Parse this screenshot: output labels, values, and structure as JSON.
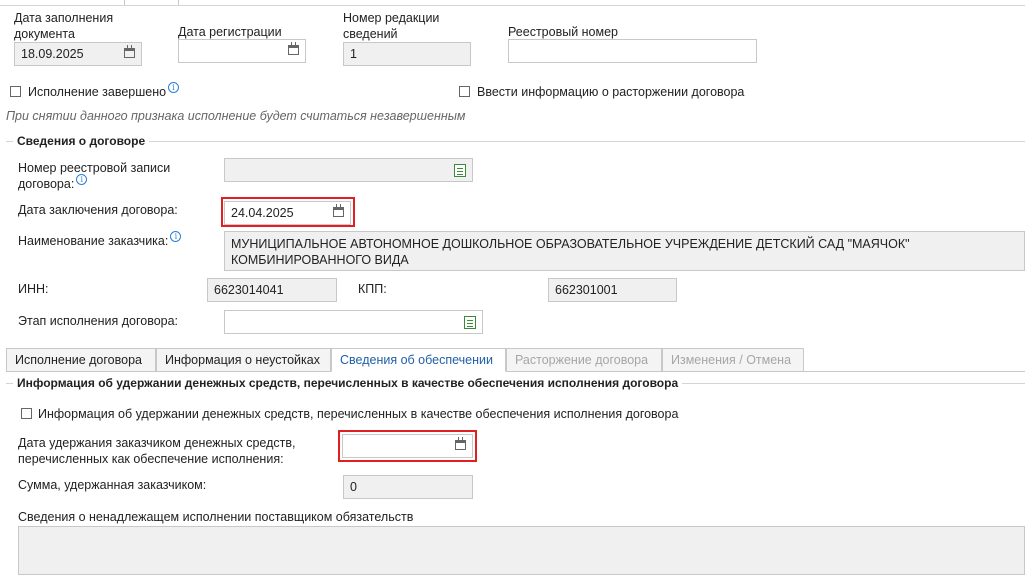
{
  "header": {
    "fill_date": {
      "label": "Дата заполнения документа",
      "value": "18.09.2025"
    },
    "reg_date": {
      "label": "Дата регистрации",
      "value": ""
    },
    "revision": {
      "label": "Номер редакции сведений",
      "value": "1"
    },
    "registry": {
      "label": "Реестровый номер",
      "value": ""
    },
    "completed_label": "Исполнение завершено",
    "termination_label": "Ввести информацию о расторжении договора",
    "hint": "При снятии данного признака исполнение будет считаться незавершенным"
  },
  "contract": {
    "section_title": "Сведения о договоре",
    "record_number": {
      "label": "Номер реестровой записи договора:",
      "value": ""
    },
    "conclusion_date": {
      "label": "Дата заключения договора:",
      "value": "24.04.2025"
    },
    "customer": {
      "label": "Наименование заказчика:",
      "value": "МУНИЦИПАЛЬНОЕ АВТОНОМНОЕ ДОШКОЛЬНОЕ ОБРАЗОВАТЕЛЬНОЕ УЧРЕЖДЕНИЕ  ДЕТСКИЙ САД \"МАЯЧОК\" КОМБИНИРОВАННОГО ВИДА"
    },
    "inn": {
      "label": "ИНН:",
      "value": "6623014041"
    },
    "kpp": {
      "label": "КПП:",
      "value": "662301001"
    },
    "stage": {
      "label": "Этап исполнения договора:",
      "value": ""
    }
  },
  "tabs": [
    {
      "label": "Исполнение договора",
      "state": "normal"
    },
    {
      "label": "Информация о неустойках",
      "state": "normal"
    },
    {
      "label": "Сведения об обеспечении",
      "state": "active"
    },
    {
      "label": "Расторжение договора",
      "state": "disabled"
    },
    {
      "label": "Изменения / Отмена",
      "state": "disabled"
    }
  ],
  "security": {
    "section_title": "Информация об удержании денежных средств, перечисленных в качестве обеспечения исполнения договора",
    "checkbox_label": "Информация об удержании денежных средств, перечисленных в качестве обеспечения исполнения договора",
    "withhold_date": {
      "label": "Дата удержания заказчиком денежных средств, перечисленных как обеспечение исполнения:",
      "value": ""
    },
    "amount": {
      "label": "Сумма, удержанная заказчиком:",
      "value": "0"
    },
    "improper_label": "Сведения о ненадлежащем исполнении поставщиком обязательств",
    "improper_value": ""
  },
  "colors": {
    "highlight": "#e02020",
    "active_tab": "#1f5fa8",
    "info_icon": "#2a7fd4"
  }
}
